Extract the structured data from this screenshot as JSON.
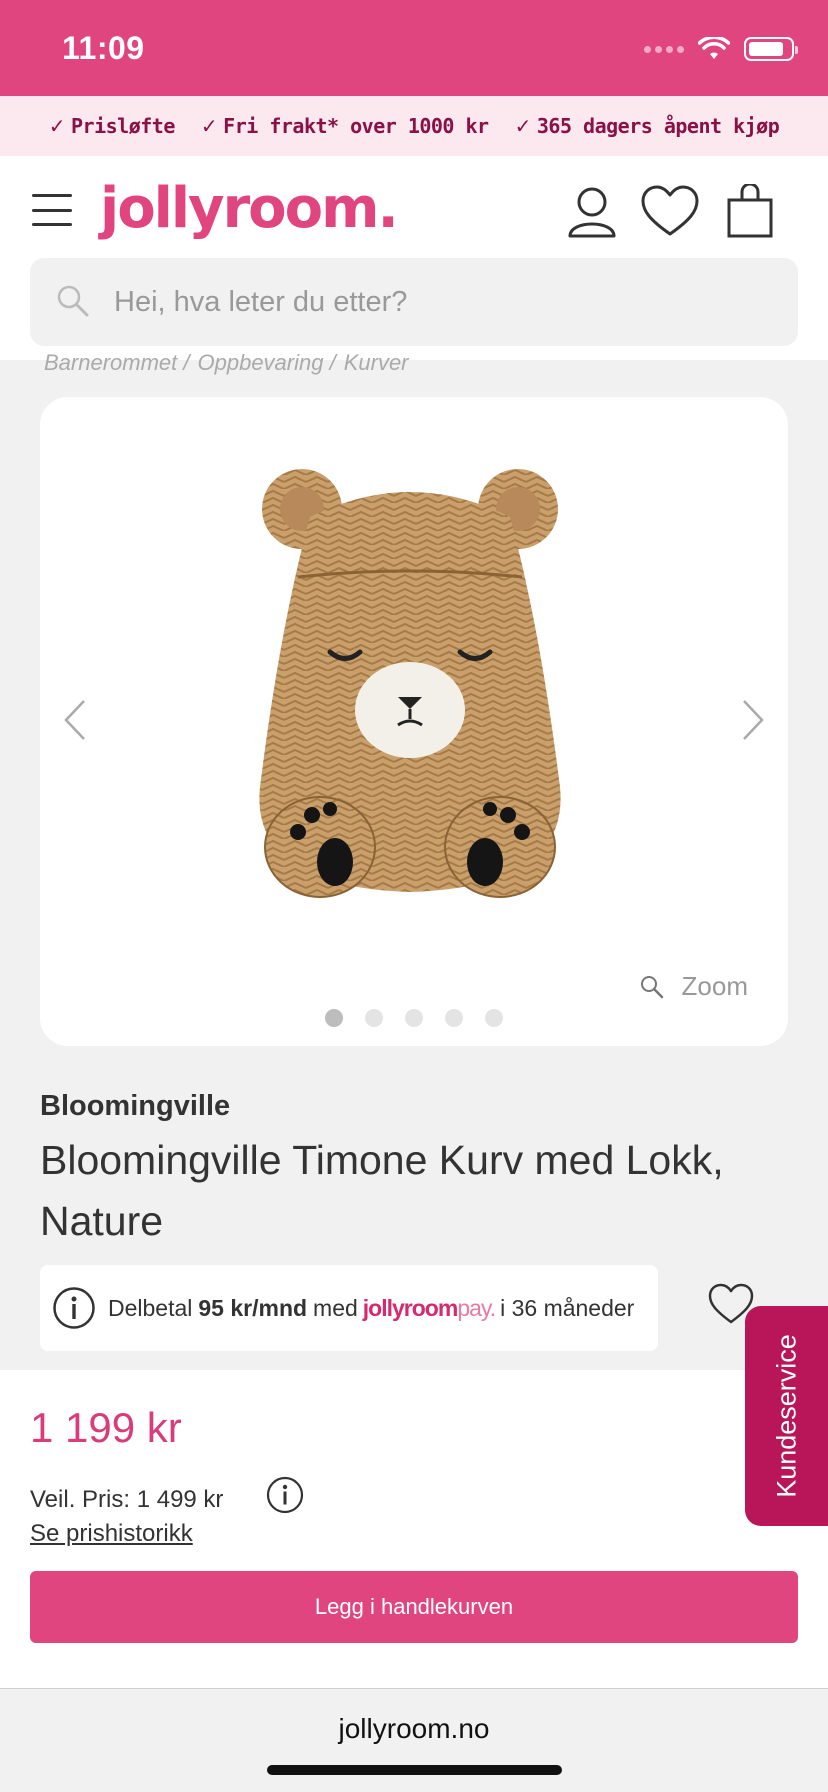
{
  "status_bar": {
    "time": "11:09"
  },
  "promo": {
    "items": [
      "Prisløfte",
      "Fri frakt* over 1000 kr",
      "365 dagers åpent kjøp"
    ]
  },
  "header": {
    "logo": "jollyroom.",
    "search_placeholder": "Hei, hva leter du etter?"
  },
  "breadcrumb": [
    "Barnerommet /",
    "Oppbevaring /",
    "Kurver"
  ],
  "gallery": {
    "zoom_label": "Zoom",
    "image_count": 5,
    "active_index": 0
  },
  "product": {
    "brand": "Bloomingville",
    "title": "Bloomingville Timone Kurv med Lokk, Nature"
  },
  "installment": {
    "prefix": "Delbetal",
    "amount": "95 kr/mnd",
    "med": "med",
    "logo_main": "jollyroom",
    "logo_pay": "pay.",
    "suffix": "i 36 måneder"
  },
  "pricing": {
    "price": "1 199 kr",
    "rrp": "Veil. Pris: 1 499 kr",
    "history_link": "Se prishistorikk",
    "cart_button": "Legg i handlekurven"
  },
  "side_tab": "Kundeservice",
  "browser": {
    "url": "jollyroom.no"
  },
  "colors": {
    "brand_pink": "#e0457f",
    "dark_pink": "#b9165a",
    "promo_bg": "#fce8ef"
  }
}
